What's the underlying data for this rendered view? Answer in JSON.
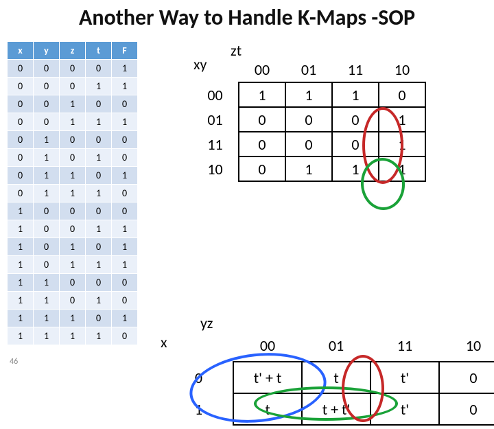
{
  "title": "Another Way to Handle K-Maps -SOP",
  "page_number": "46",
  "truth_table": {
    "headers": [
      "x",
      "y",
      "z",
      "t",
      "F"
    ],
    "rows": [
      [
        "0",
        "0",
        "0",
        "0",
        "1"
      ],
      [
        "0",
        "0",
        "0",
        "1",
        "1"
      ],
      [
        "0",
        "0",
        "1",
        "0",
        "0"
      ],
      [
        "0",
        "0",
        "1",
        "1",
        "1"
      ],
      [
        "0",
        "1",
        "0",
        "0",
        "0"
      ],
      [
        "0",
        "1",
        "0",
        "1",
        "0"
      ],
      [
        "0",
        "1",
        "1",
        "0",
        "1"
      ],
      [
        "0",
        "1",
        "1",
        "1",
        "0"
      ],
      [
        "1",
        "0",
        "0",
        "0",
        "0"
      ],
      [
        "1",
        "0",
        "0",
        "1",
        "1"
      ],
      [
        "1",
        "0",
        "1",
        "0",
        "1"
      ],
      [
        "1",
        "0",
        "1",
        "1",
        "1"
      ],
      [
        "1",
        "1",
        "0",
        "0",
        "0"
      ],
      [
        "1",
        "1",
        "0",
        "1",
        "0"
      ],
      [
        "1",
        "1",
        "1",
        "0",
        "1"
      ],
      [
        "1",
        "1",
        "1",
        "1",
        "0"
      ]
    ]
  },
  "kmap1": {
    "top_vars": "zt",
    "left_vars": "xy",
    "cols": [
      "00",
      "01",
      "11",
      "10"
    ],
    "rows": [
      "00",
      "01",
      "11",
      "10"
    ],
    "cells": [
      [
        "1",
        "1",
        "1",
        "0"
      ],
      [
        "0",
        "0",
        "0",
        "1"
      ],
      [
        "0",
        "0",
        "0",
        "1"
      ],
      [
        "0",
        "1",
        "1",
        "1"
      ]
    ]
  },
  "kmap2": {
    "top_vars": "yz",
    "left_vars": "x",
    "cols": [
      "00",
      "01",
      "11",
      "10"
    ],
    "rows": [
      "0",
      "1"
    ],
    "cells": [
      [
        "t' + t",
        "t",
        "t'",
        "0"
      ],
      [
        "t",
        "t + t'",
        "t'",
        "0"
      ]
    ]
  }
}
